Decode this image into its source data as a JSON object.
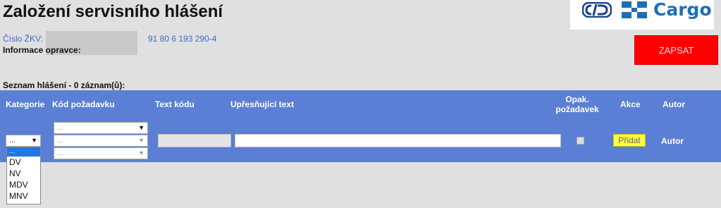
{
  "header": {
    "title": "Založení servisního hlášení",
    "logo_cargo_text": "Cargo"
  },
  "info": {
    "zkv_label": "Číslo ŽKV:",
    "zkv_value": "91 80 6 193 290-4",
    "repair_info_label": "Informace opravce:"
  },
  "actions": {
    "zapsat_label": "ZAPSAT"
  },
  "list": {
    "title": "Seznam hlášení - 0 záznam(ů):"
  },
  "table": {
    "columns": {
      "category": "Kategorie",
      "request_code": "Kód požadavku",
      "code_text": "Text kódu",
      "detail_text": "Upřesňující text",
      "repeat_line1": "Opak.",
      "repeat_line2": "požadavek",
      "action": "Akce",
      "author": "Autor"
    },
    "row": {
      "category_value": "...",
      "request_code_values": [
        "...",
        "...",
        "..."
      ],
      "add_label": "Přidat",
      "author_value": "Autor"
    }
  },
  "category_dropdown": {
    "options": [
      "...",
      "DV",
      "NV",
      "MDV",
      "MNV"
    ],
    "selected_index": 0
  },
  "colors": {
    "table_header_bg": "#5b7fd4",
    "zapsat_bg": "#ff0000",
    "add_button_bg": "#ffff44",
    "link_blue": "#3a6cc8",
    "logo_blue": "#1b6fb8"
  }
}
